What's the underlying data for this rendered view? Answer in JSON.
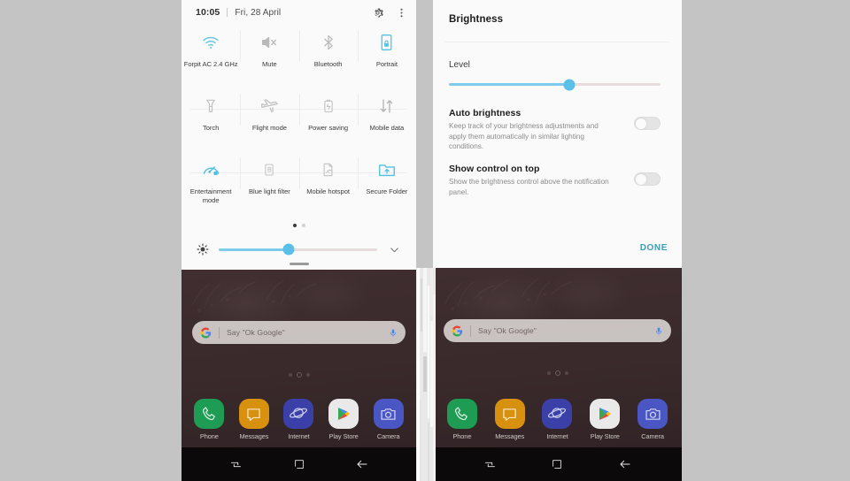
{
  "background_color": "#c4c4c4",
  "accent_color": "#5bc0e8",
  "quick_panel": {
    "status_bar": {
      "time": "10:05",
      "date": "Fri, 28 April",
      "settings_icon": "gear-icon",
      "more_icon": "more-vertical-icon"
    },
    "toggles": [
      {
        "label": "Forpit AC 2.4 GHz",
        "icon": "wifi-icon",
        "state": "on"
      },
      {
        "label": "Mute",
        "icon": "mute-icon",
        "state": "off"
      },
      {
        "label": "Bluetooth",
        "icon": "bluetooth-icon",
        "state": "off"
      },
      {
        "label": "Portrait",
        "icon": "screen-rotation-lock-icon",
        "state": "on"
      },
      {
        "label": "Torch",
        "icon": "torch-icon",
        "state": "off"
      },
      {
        "label": "Flight mode",
        "icon": "airplane-icon",
        "state": "off"
      },
      {
        "label": "Power saving",
        "icon": "battery-saving-icon",
        "state": "off"
      },
      {
        "label": "Mobile data",
        "icon": "data-transfer-icon",
        "state": "off"
      },
      {
        "label": "Entertainment mode",
        "icon": "entertainment-icon",
        "state": "on"
      },
      {
        "label": "Blue light filter",
        "icon": "blue-light-filter-icon",
        "state": "off"
      },
      {
        "label": "Mobile hotspot",
        "icon": "hotspot-icon",
        "state": "off"
      },
      {
        "label": "Secure Folder",
        "icon": "secure-folder-icon",
        "state": "on"
      }
    ],
    "page_indicator": {
      "total": 2,
      "active": 1
    },
    "brightness": {
      "icon": "brightness-icon",
      "value_percent": 44,
      "expand_icon": "chevron-down-icon"
    }
  },
  "brightness_sheet": {
    "title": "Brightness",
    "level_label": "Level",
    "level_percent": 57,
    "options": [
      {
        "title": "Auto brightness",
        "description": "Keep track of your brightness adjustments and apply them automatically in similar lighting conditions.",
        "state": "off"
      },
      {
        "title": "Show control on top",
        "description": "Show the brightness control above the notification panel.",
        "state": "off"
      }
    ],
    "done_label": "DONE"
  },
  "home_screen": {
    "search": {
      "placeholder": "Say \"Ok Google\"",
      "google_icon": "google-g-icon",
      "mic_icon": "microphone-icon"
    },
    "page_indicator": {
      "total": 3,
      "active": 2
    },
    "dock": [
      {
        "label": "Phone",
        "icon": "phone-icon",
        "color": "#1f9c54"
      },
      {
        "label": "Messages",
        "icon": "messages-icon",
        "color": "#d8900f"
      },
      {
        "label": "Internet",
        "icon": "internet-icon",
        "color": "#3b3fa8"
      },
      {
        "label": "Play Store",
        "icon": "play-store-icon",
        "color": "#e9e9e9"
      },
      {
        "label": "Camera",
        "icon": "camera-icon",
        "color": "#4a56c4"
      }
    ],
    "navigation": [
      {
        "label": "Recents",
        "icon": "recents-icon"
      },
      {
        "label": "Home",
        "icon": "home-icon"
      },
      {
        "label": "Back",
        "icon": "back-icon"
      }
    ]
  }
}
